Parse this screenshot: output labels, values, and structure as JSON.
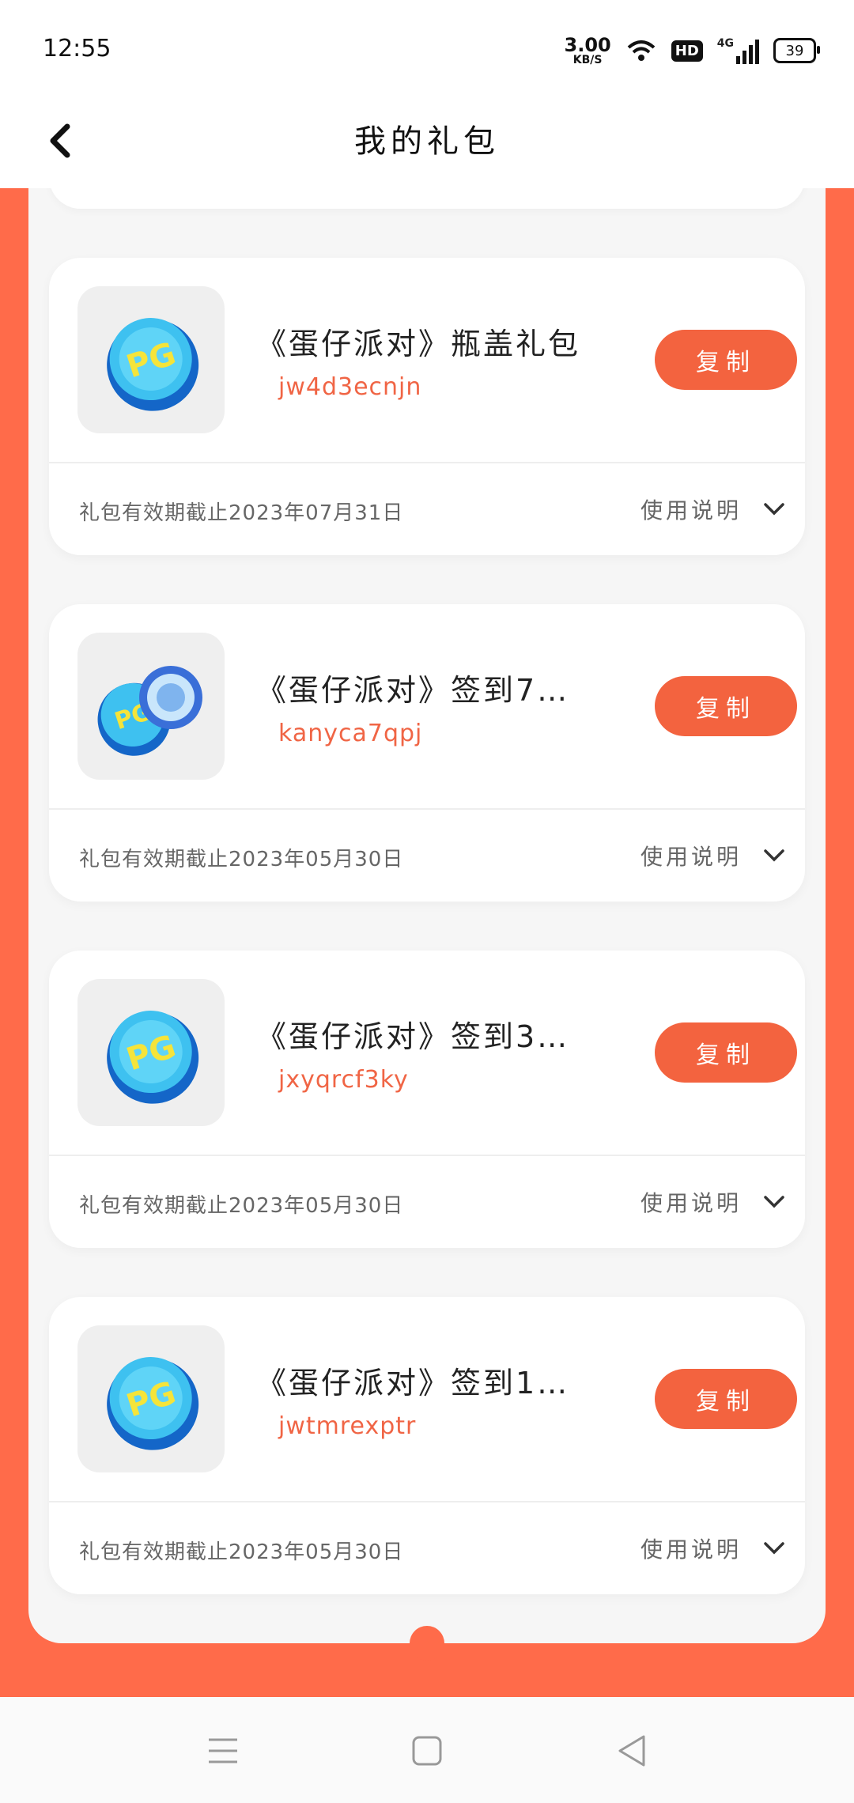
{
  "status": {
    "time": "12:55",
    "speed_value": "3.00",
    "speed_unit": "KB/S",
    "hd": "HD",
    "network": "4G",
    "battery": "39"
  },
  "header": {
    "title": "我的礼包"
  },
  "colors": {
    "accent": "#ff6b4a",
    "button": "#f3633f",
    "code": "#f06545"
  },
  "gifts": [
    {
      "title": "《蛋仔派对》瓶盖礼包",
      "code": "jw4d3ecnjn",
      "copy_label": "复制",
      "expiry": "礼包有效期截止2023年07月31日",
      "usage_label": "使用说明",
      "icon": "bottle-cap-icon"
    },
    {
      "title": "《蛋仔派对》签到7…",
      "code": "kanyca7qpj",
      "copy_label": "复制",
      "expiry": "礼包有效期截止2023年05月30日",
      "usage_label": "使用说明",
      "icon": "bottle-cap-and-orb-icon"
    },
    {
      "title": "《蛋仔派对》签到3…",
      "code": "jxyqrcf3ky",
      "copy_label": "复制",
      "expiry": "礼包有效期截止2023年05月30日",
      "usage_label": "使用说明",
      "icon": "bottle-cap-icon"
    },
    {
      "title": "《蛋仔派对》签到1…",
      "code": "jwtmrexptr",
      "copy_label": "复制",
      "expiry": "礼包有效期截止2023年05月30日",
      "usage_label": "使用说明",
      "icon": "bottle-cap-icon"
    }
  ]
}
